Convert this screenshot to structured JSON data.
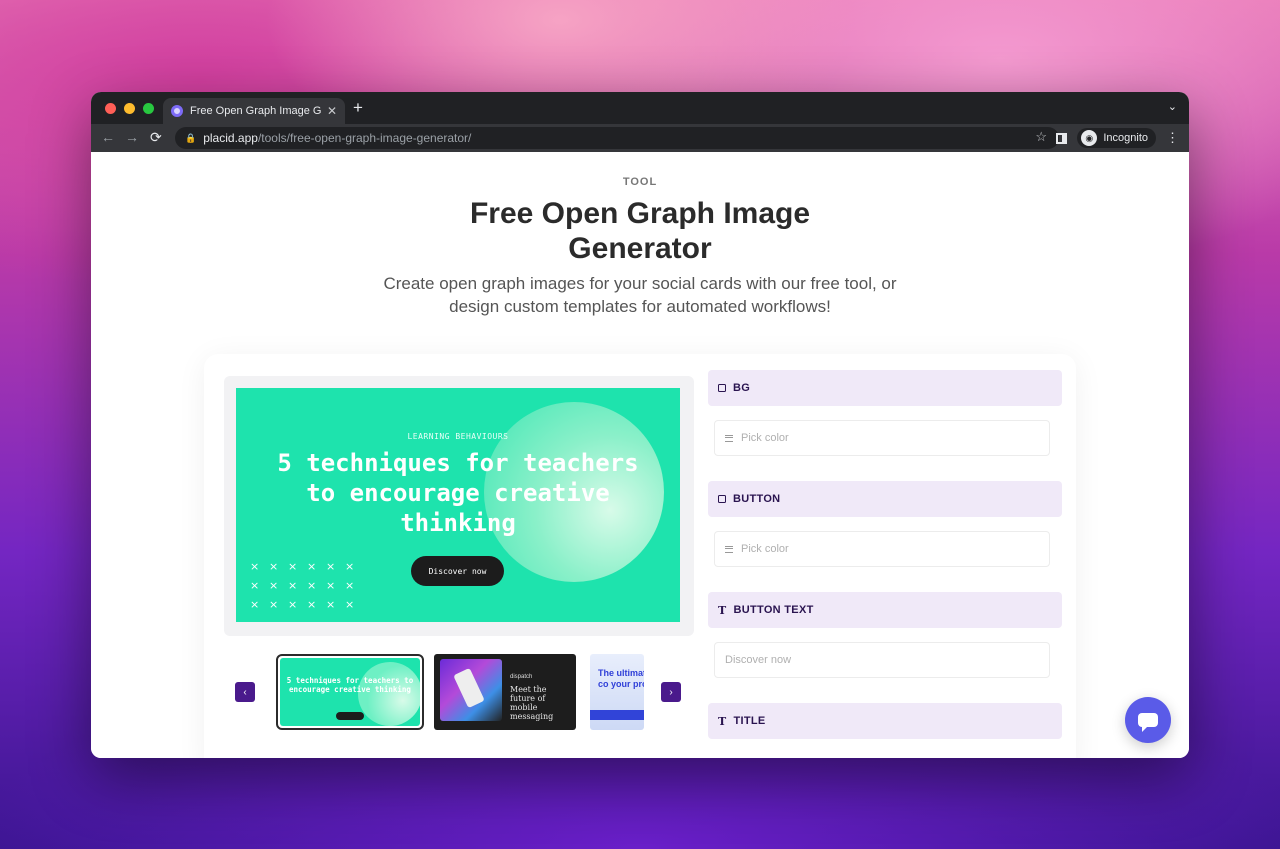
{
  "browser": {
    "tab_title": "Free Open Graph Image Generat",
    "tab_close": "✕",
    "new_tab": "+",
    "tab_menu": "⌄",
    "back": "←",
    "forward": "→",
    "reload": "⟳",
    "url_host": "placid.app",
    "url_path": "/tools/free-open-graph-image-generator/",
    "star": "☆",
    "profile_label": "Incognito",
    "menu": "⋮",
    "traffic_lights": [
      "#ff5f57",
      "#febc2e",
      "#28c840"
    ]
  },
  "page": {
    "eyebrow": "TOOL",
    "title": "Free Open Graph Image Generator",
    "subtitle": "Create open graph images for your social cards with our free tool, or design custom templates for automated workflows!"
  },
  "preview": {
    "eyebrow": "LEARNING BEHAVIOURS",
    "headline": "5 techniques for teachers to encourage creative thinking",
    "button": "Discover now",
    "background_color": "#1ee3ad"
  },
  "carousel": {
    "prev": "‹",
    "next": "›",
    "thumb1_text": "5 techniques for teachers to encourage creative thinking",
    "thumb2_logo": "dispatch",
    "thumb2_text": "Meet the future of mobile messaging",
    "thumb3_text": "The ultimate create co your proc"
  },
  "properties": [
    {
      "label": "BG",
      "icon": "square-icon",
      "field_placeholder": "Pick color"
    },
    {
      "label": "BUTTON",
      "icon": "square-icon",
      "field_placeholder": "Pick color"
    },
    {
      "label": "BUTTON TEXT",
      "icon": "text-icon",
      "field_placeholder": "Discover now"
    },
    {
      "label": "TITLE",
      "icon": "text-icon"
    }
  ],
  "colors": {
    "accent": "#4a1a8c",
    "property_header": "#f0e9f8",
    "chat_button": "#5a5be8"
  }
}
